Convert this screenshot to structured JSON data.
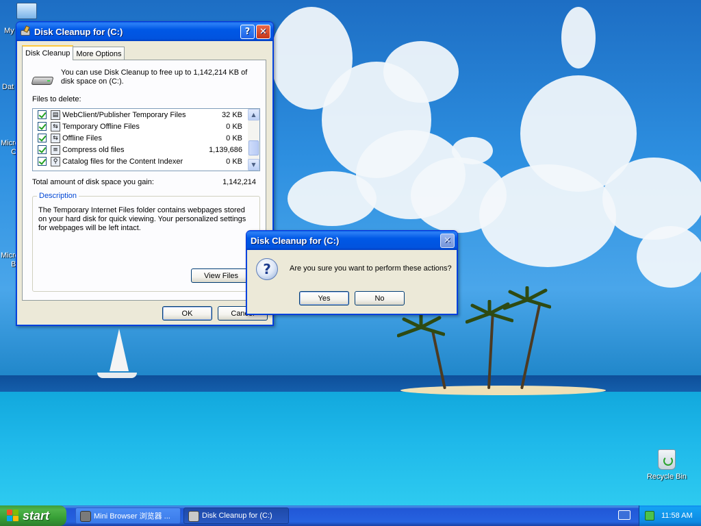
{
  "desktop": {
    "icons": [
      {
        "label": "My"
      },
      {
        "label": "Dat"
      },
      {
        "label": "Micro"
      },
      {
        "label": "C"
      },
      {
        "label": "Micro"
      },
      {
        "label": "B"
      }
    ],
    "recycle_bin": {
      "label": "Recycle Bin"
    }
  },
  "cleanup_window": {
    "title": "Disk Cleanup for  (C:)",
    "tabs": [
      {
        "label": "Disk Cleanup",
        "selected": true
      },
      {
        "label": "More Options",
        "selected": false
      }
    ],
    "intro": "You can use Disk Cleanup to free up to 1,142,214 KB of disk space on  (C:).",
    "files_label": "Files to delete:",
    "files": [
      {
        "name": "WebClient/Publisher Temporary Files",
        "size": "32 KB",
        "checked": true,
        "icon": "webpage-icon"
      },
      {
        "name": "Temporary Offline Files",
        "size": "0 KB",
        "checked": true,
        "icon": "offline-files-icon"
      },
      {
        "name": "Offline Files",
        "size": "0 KB",
        "checked": true,
        "icon": "offline-files-icon"
      },
      {
        "name": "Compress old files",
        "size": "1,139,686",
        "checked": true,
        "icon": "compress-icon"
      },
      {
        "name": "Catalog files for the Content Indexer",
        "size": "0 KB",
        "checked": true,
        "icon": "indexer-icon"
      }
    ],
    "total_label": "Total amount of disk space you gain:",
    "total_value": "1,142,214",
    "description_legend": "Description",
    "description_text": "The Temporary Internet Files folder contains webpages stored on your hard disk for quick viewing. Your personalized settings for webpages will be left intact.",
    "view_files_label": "View Files",
    "ok_label": "OK",
    "cancel_label": "Cancel",
    "help_glyph": "?",
    "close_glyph": "✕"
  },
  "confirm_dialog": {
    "title": "Disk Cleanup for  (C:)",
    "message": "Are you sure you want to perform these actions?",
    "icon_glyph": "?",
    "yes_label": "Yes",
    "no_label": "No",
    "close_glyph": "✕"
  },
  "taskbar": {
    "start_label": "start",
    "tasks": [
      {
        "label": "Mini Browser 浏览器 ...",
        "active": false
      },
      {
        "label": "Disk Cleanup for  (C:)",
        "active": true
      }
    ],
    "clock": "11:58 AM"
  },
  "colors": {
    "title_blue": "#0058e6",
    "start_green": "#3c9b3c",
    "check_green": "#21a121",
    "description_legend": "#0046d5"
  }
}
